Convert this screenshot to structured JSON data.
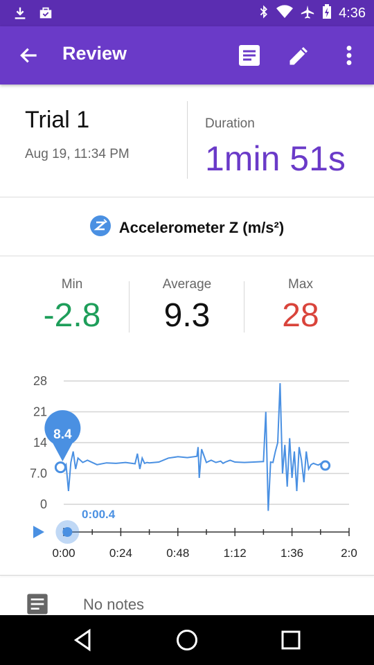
{
  "status_bar": {
    "time": "4:36"
  },
  "app_bar": {
    "title": "Review",
    "actions": [
      "notes-icon",
      "edit-icon",
      "overflow-menu-icon"
    ]
  },
  "trial": {
    "title": "Trial 1",
    "date": "Aug 19, 11:34 PM",
    "duration_label": "Duration",
    "duration_value": "1min 51s"
  },
  "sensor": {
    "name": "Accelerometer Z (m/s²)",
    "icon": "accelerometer-z-icon"
  },
  "stats": {
    "min_label": "Min",
    "min_value": "-2.8",
    "avg_label": "Average",
    "avg_value": "9.3",
    "max_label": "Max",
    "max_value": "28"
  },
  "colors": {
    "primary": "#6a3ac8",
    "status_bar": "#5b2db1",
    "series": "#4a90e2",
    "min": "#1e9e5a",
    "max": "#d9443b"
  },
  "playback": {
    "position_label": "0:00.4",
    "marker_value": "8.4"
  },
  "chart_data": {
    "type": "line",
    "ylim": [
      -2.8,
      28
    ],
    "y_ticks": [
      "28",
      "21",
      "14",
      "7.0",
      "0"
    ],
    "x_ticks": [
      "0:00",
      "0:24",
      "0:48",
      "1:12",
      "1:36",
      "2:0"
    ],
    "series": [
      {
        "x": [
          0.4,
          1,
          2,
          3,
          4,
          5,
          6,
          8,
          10,
          14,
          18,
          22,
          26,
          30,
          31,
          32,
          33,
          34,
          35,
          36,
          40,
          44,
          48,
          52,
          56,
          56.5,
          57,
          58,
          60,
          62,
          64,
          66,
          67,
          68,
          69,
          70,
          72,
          76,
          80,
          84,
          85,
          86,
          87,
          88,
          89,
          90,
          91,
          92,
          93,
          94,
          95,
          96,
          97,
          98,
          99,
          100,
          101,
          102,
          103,
          104,
          105,
          106,
          107,
          108,
          109,
          110
        ],
        "y": [
          8.4,
          9.0,
          3.0,
          9.5,
          12.0,
          8.0,
          10.5,
          9.5,
          10.0,
          9.0,
          9.4,
          9.3,
          9.5,
          9.2,
          11.5,
          8.0,
          10.5,
          9.3,
          9.5,
          9.4,
          9.6,
          10.5,
          10.8,
          10.6,
          10.9,
          13.0,
          6.0,
          12.5,
          9.5,
          10.0,
          9.5,
          9.8,
          9.3,
          9.6,
          9.8,
          10.0,
          9.6,
          9.5,
          9.6,
          9.7,
          21.0,
          -1.5,
          9.6,
          9.5,
          12.0,
          14.0,
          27.5,
          7.0,
          13.5,
          4.0,
          15.0,
          6.0,
          12.0,
          3.0,
          13.0,
          10.0,
          5.0,
          12.0,
          8.0,
          9.0,
          9.3,
          9.1,
          8.9,
          9.2,
          9.3,
          8.8
        ]
      }
    ],
    "xlim": [
      0,
      120
    ]
  },
  "notes": {
    "text": "No notes"
  }
}
